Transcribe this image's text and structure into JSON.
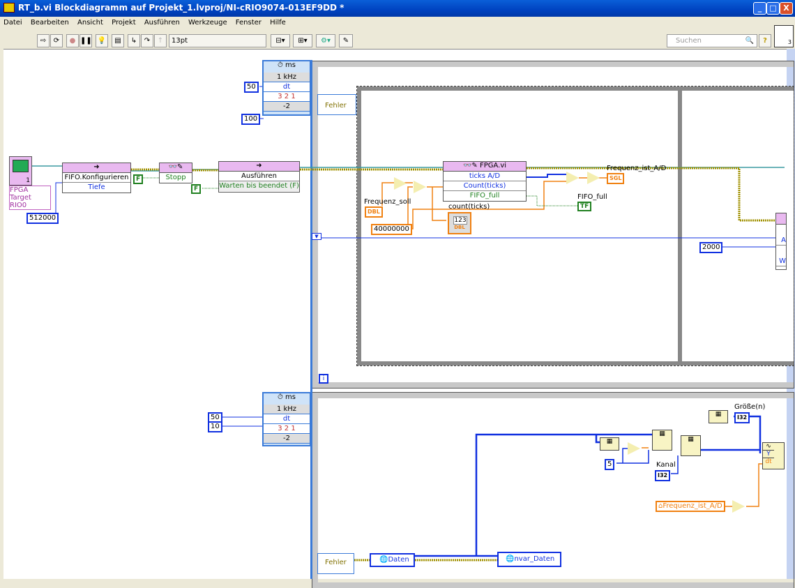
{
  "window": {
    "title": "RT_b.vi Blockdiagramm auf Projekt_1.lvproj/NI-cRIO9074-013EF9DD *",
    "buttons": [
      "_",
      "□",
      "X"
    ]
  },
  "menu": [
    "Datei",
    "Bearbeiten",
    "Ansicht",
    "Projekt",
    "Ausführen",
    "Werkzeuge",
    "Fenster",
    "Hilfe"
  ],
  "toolbar": {
    "font": "13pt Anwendungsschriftart",
    "search_placeholder": "Suchen",
    "help": "?",
    "connector_num": "3"
  },
  "diagram": {
    "fpga_target": {
      "label": "FPGA Target RIO0",
      "num": "1"
    },
    "depth_const": "512000",
    "fifo_config": {
      "title": "FIFO.Konfigurieren",
      "row": "Tiefe"
    },
    "stop_node": {
      "row": "Stopp",
      "const": "F"
    },
    "run_node": {
      "title": "Ausführen",
      "row": "Warten bis beendet (F)",
      "const": "F"
    },
    "timed_loop1": {
      "unit": "ms",
      "clock": "1 kHz",
      "dt": "dt",
      "offset": "3 2 1",
      "priority": "-2",
      "period": "50",
      "prio_const": "100",
      "error": "Fehler",
      "iter": "i"
    },
    "fpga_vi": {
      "title": "FPGA.vi",
      "rows": [
        "ticks A/D",
        "Count(ticks)",
        "FIFO_full"
      ]
    },
    "frequenz_soll": {
      "label": "Frequenz_soll",
      "type": "DBL"
    },
    "clock_const": "40000000",
    "count_ticks": {
      "label": "count(ticks)",
      "value": "123",
      "type": "DBL"
    },
    "frequenz_ist": {
      "label": "Frequenz_ist_A/D",
      "type": "SGL"
    },
    "fifo_full": {
      "label": "FIFO_full",
      "type": "TF"
    },
    "timeout_const": "2000",
    "right_node_rows": [
      "A",
      "W"
    ],
    "timed_loop2": {
      "unit": "ms",
      "clock": "1 kHz",
      "dt": "dt",
      "offset": "3 2 1",
      "priority": "-2",
      "period": "50",
      "offset_const": "10",
      "error": "Fehler"
    },
    "daten": "Daten",
    "nvar_daten": "nvar_Daten",
    "five_const": "5",
    "kanal": {
      "label": "Kanal",
      "type": "I32"
    },
    "groesse": {
      "label": "Größe(n)",
      "type": "I32"
    },
    "freq_local": "Frequenz_ist_A/D",
    "waveform": {
      "y": "Y",
      "dt": "dt"
    }
  },
  "colors": {
    "title_bar": "#0042c0",
    "int_wire": "#1030e0",
    "float_wire": "#f08010",
    "bool_wire": "#208020",
    "error_wire": "#a09000",
    "node_header": "#e9b9f0"
  }
}
